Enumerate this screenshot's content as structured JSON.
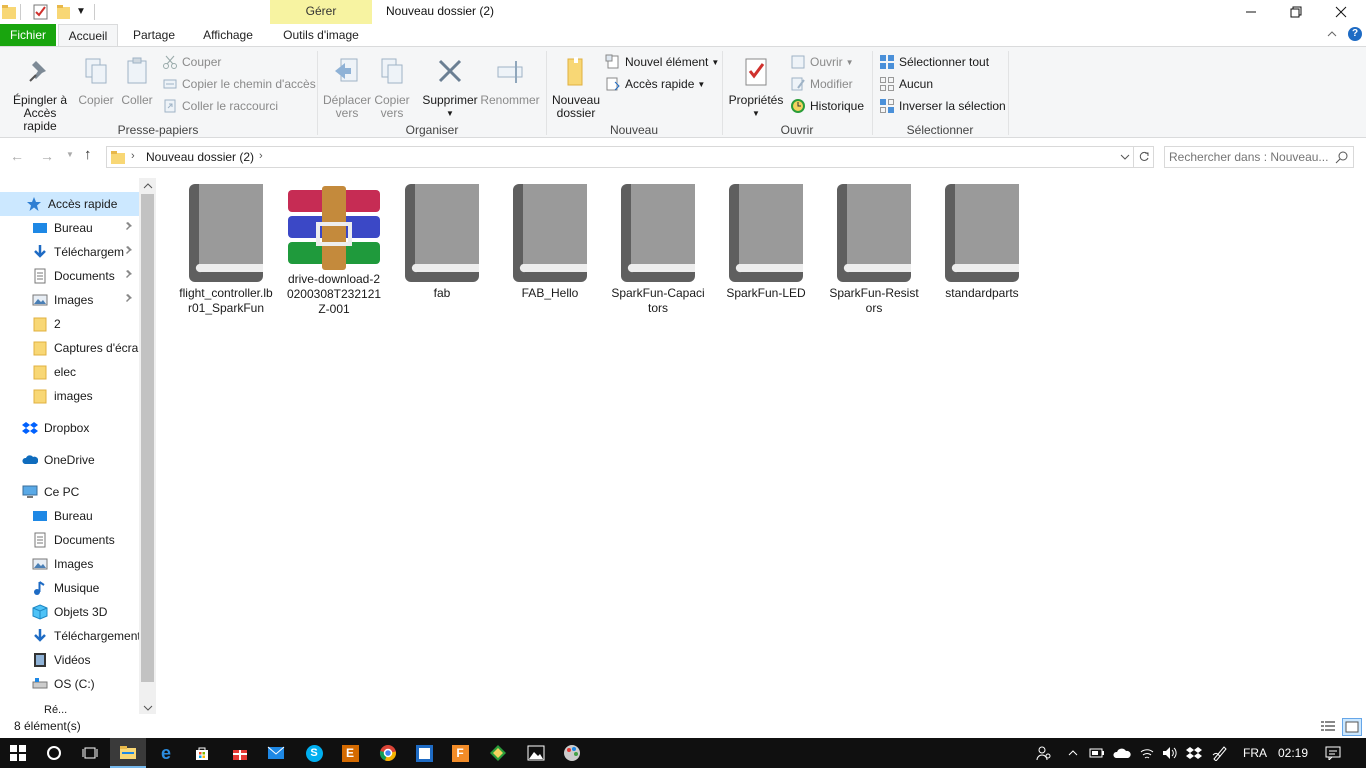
{
  "window": {
    "title": "Nouveau dossier (2)",
    "context_group": "Gérer",
    "context_tab": "Outils d'image"
  },
  "tabs": {
    "file": "Fichier",
    "home": "Accueil",
    "share": "Partage",
    "view": "Affichage"
  },
  "ribbon": {
    "clipboard": {
      "label": "Presse-papiers",
      "pin_line1": "Épingler à",
      "pin_line2": "Accès rapide",
      "copy": "Copier",
      "paste": "Coller",
      "cut": "Couper",
      "copy_path": "Copier le chemin d'accès",
      "paste_shortcut": "Coller le raccourci"
    },
    "organize": {
      "label": "Organiser",
      "move_line1": "Déplacer",
      "move_line2": "vers",
      "copyto_line1": "Copier",
      "copyto_line2": "vers",
      "delete": "Supprimer",
      "rename": "Renommer"
    },
    "new": {
      "label": "Nouveau",
      "new_folder_line1": "Nouveau",
      "new_folder_line2": "dossier",
      "new_item": "Nouvel élément",
      "quick_access": "Accès rapide"
    },
    "open": {
      "label": "Ouvrir",
      "properties": "Propriétés",
      "open": "Ouvrir",
      "edit": "Modifier",
      "history": "Historique"
    },
    "select": {
      "label": "Sélectionner",
      "select_all": "Sélectionner tout",
      "select_none": "Aucun",
      "invert": "Inverser la sélection"
    }
  },
  "address": {
    "path": "Nouveau dossier (2)",
    "search_placeholder": "Rechercher dans : Nouveau..."
  },
  "nav": {
    "quick_access": "Accès rapide",
    "qa_items": [
      "Bureau",
      "Téléchargem",
      "Documents",
      "Images",
      "2",
      "Captures d'écran",
      "elec",
      "images"
    ],
    "dropbox": "Dropbox",
    "onedrive": "OneDrive",
    "this_pc": "Ce PC",
    "pc_items": [
      "Bureau",
      "Documents",
      "Images",
      "Musique",
      "Objets 3D",
      "Téléchargements",
      "Vidéos",
      "OS (C:)"
    ],
    "cut_off": "Ré..."
  },
  "files": [
    {
      "name": "flight_controller.lbr01_SparkFun",
      "icon": "book-icon"
    },
    {
      "name": "drive-download-20200308T232121Z-001",
      "icon": "winrar-archive-icon"
    },
    {
      "name": "fab",
      "icon": "book-icon"
    },
    {
      "name": "FAB_Hello",
      "icon": "book-icon"
    },
    {
      "name": "SparkFun-Capacitors",
      "icon": "book-icon"
    },
    {
      "name": "SparkFun-LED",
      "icon": "book-icon"
    },
    {
      "name": "SparkFun-Resistors",
      "icon": "book-icon"
    },
    {
      "name": "standardparts",
      "icon": "book-icon"
    }
  ],
  "status": {
    "count": "8 élément(s)"
  },
  "taskbar": {
    "language": "FRA",
    "time": "02:19"
  },
  "colors": {
    "file_tab": "#19a50e",
    "context_tab": "#f7f3a1",
    "selection": "#cce8ff",
    "taskbar": "#101010",
    "accent": "#0078d7"
  }
}
